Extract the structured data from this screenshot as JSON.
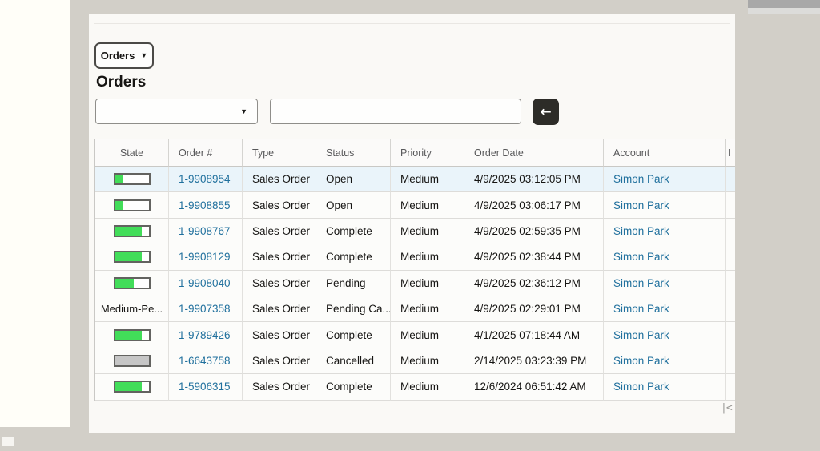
{
  "colors": {
    "canvas_bg": "#d2cfc8",
    "left_panel_bg": "#fffef8",
    "card_bg": "#faf9f6",
    "link_color": "#20709d",
    "progress_green": "#42dd59",
    "progress_gray": "#c6c6c6",
    "selected_row_bg": "#eaf4fa",
    "submit_button_bg": "#2d2c28"
  },
  "toolbar": {
    "menu_button_label": "Orders",
    "menu_button_caret": "▼",
    "page_title": "Orders",
    "filter_select": {
      "value": "",
      "caret": "▼"
    },
    "search_input": {
      "value": "",
      "placeholder": ""
    },
    "submit_button_icon": "←"
  },
  "table": {
    "columns": [
      "State",
      "Order #",
      "Type",
      "Status",
      "Priority",
      "Order Date",
      "Account"
    ],
    "clipped_column_fragment": "I",
    "rows": [
      {
        "state": {
          "kind": "bar",
          "fill_pct": 26,
          "color": "green"
        },
        "order_number": "1-9908954",
        "type": "Sales Order",
        "status": "Open",
        "priority": "Medium",
        "order_date": "4/9/2025 03:12:05 PM",
        "account": "Simon Park",
        "selected": true
      },
      {
        "state": {
          "kind": "bar",
          "fill_pct": 26,
          "color": "green"
        },
        "order_number": "1-9908855",
        "type": "Sales Order",
        "status": "Open",
        "priority": "Medium",
        "order_date": "4/9/2025 03:06:17 PM",
        "account": "Simon Park",
        "selected": false
      },
      {
        "state": {
          "kind": "bar",
          "fill_pct": 80,
          "color": "green"
        },
        "order_number": "1-9908767",
        "type": "Sales Order",
        "status": "Complete",
        "priority": "Medium",
        "order_date": "4/9/2025 02:59:35 PM",
        "account": "Simon Park",
        "selected": false
      },
      {
        "state": {
          "kind": "bar",
          "fill_pct": 80,
          "color": "green"
        },
        "order_number": "1-9908129",
        "type": "Sales Order",
        "status": "Complete",
        "priority": "Medium",
        "order_date": "4/9/2025 02:38:44 PM",
        "account": "Simon Park",
        "selected": false
      },
      {
        "state": {
          "kind": "bar",
          "fill_pct": 57,
          "color": "green"
        },
        "order_number": "1-9908040",
        "type": "Sales Order",
        "status": "Pending",
        "priority": "Medium",
        "order_date": "4/9/2025 02:36:12 PM",
        "account": "Simon Park",
        "selected": false
      },
      {
        "state": {
          "kind": "text",
          "label": "Medium-Pe..."
        },
        "order_number": "1-9907358",
        "type": "Sales Order",
        "status": "Pending Ca...",
        "priority": "Medium",
        "order_date": "4/9/2025 02:29:01 PM",
        "account": "Simon Park",
        "selected": false
      },
      {
        "state": {
          "kind": "bar",
          "fill_pct": 80,
          "color": "green"
        },
        "order_number": "1-9789426",
        "type": "Sales Order",
        "status": "Complete",
        "priority": "Medium",
        "order_date": "4/1/2025 07:18:44 AM",
        "account": "Simon Park",
        "selected": false
      },
      {
        "state": {
          "kind": "bar",
          "fill_pct": 100,
          "color": "gray"
        },
        "order_number": "1-6643758",
        "type": "Sales Order",
        "status": "Cancelled",
        "priority": "Medium",
        "order_date": "2/14/2025 03:23:39 PM",
        "account": "Simon Park",
        "selected": false
      },
      {
        "state": {
          "kind": "bar",
          "fill_pct": 80,
          "color": "green"
        },
        "order_number": "1-5906315",
        "type": "Sales Order",
        "status": "Complete",
        "priority": "Medium",
        "order_date": "12/6/2024 06:51:42 AM",
        "account": "Simon Park",
        "selected": false
      }
    ]
  },
  "pagination": {
    "first_page_icon": "|<"
  }
}
